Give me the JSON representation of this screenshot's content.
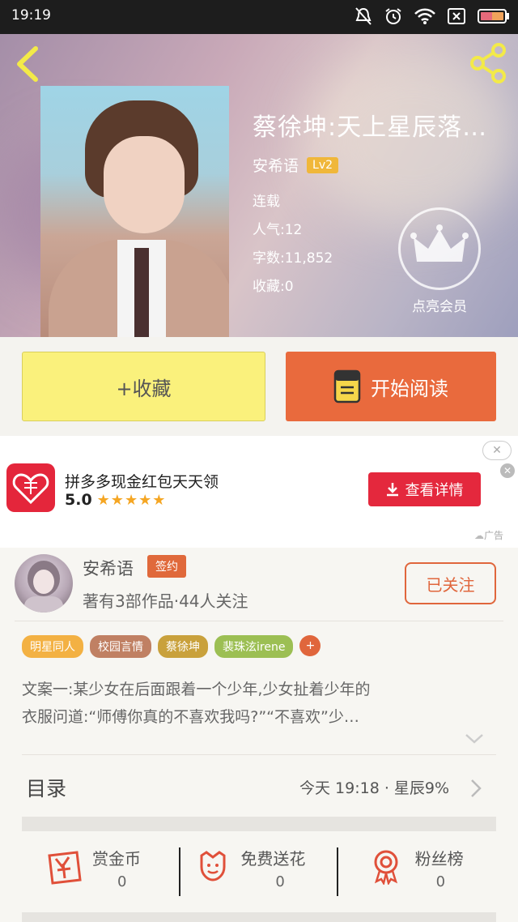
{
  "status_bar": {
    "time": "19:19"
  },
  "header": {
    "book_title": "蔡徐坤:天上星辰落凡…",
    "author": "安希语",
    "level": "Lv2",
    "status": "连载",
    "popularity": "人气:12",
    "word_count": "字数:11,852",
    "favorites": "收藏:0",
    "vip_label": "点亮会员"
  },
  "actions": {
    "collect_label": "+收藏",
    "read_label": "开始阅读"
  },
  "ad": {
    "title": "拼多多现金红包天天领",
    "rating": "5.0",
    "stars": "★★★★★",
    "cta_label": "查看详情",
    "close_top": "✕",
    "close_x": "✕",
    "tag": "广告",
    "colors": {
      "brand": "#e4263b"
    }
  },
  "author_panel": {
    "name": "安希语",
    "sign_badge": "签约",
    "stats": "著有3部作品·44人关注",
    "follow_label": "已关注"
  },
  "tags": [
    {
      "label": "明星同人",
      "color": "#f3b143"
    },
    {
      "label": "校园言情",
      "color": "#c08063"
    },
    {
      "label": "蔡徐坤",
      "color": "#c9a13c"
    },
    {
      "label": "裴珠泫irene",
      "color": "#9cbf53"
    },
    {
      "label": "+",
      "color": "#e0663c"
    }
  ],
  "synopsis": {
    "line1": "文案一:某少女在后面跟着一个少年,少女扯着少年的",
    "line2": "衣服问道:“师傅你真的不喜欢我吗?”“不喜欢”少…"
  },
  "toc": {
    "title": "目录",
    "info": "今天 19:18 · 星辰9%"
  },
  "rewards": [
    {
      "label": "赏金币",
      "count": "0",
      "icon": "red-envelope-icon"
    },
    {
      "label": "免费送花",
      "count": "0",
      "icon": "flower-icon"
    },
    {
      "label": "粉丝榜",
      "count": "0",
      "icon": "medal-icon"
    }
  ]
}
